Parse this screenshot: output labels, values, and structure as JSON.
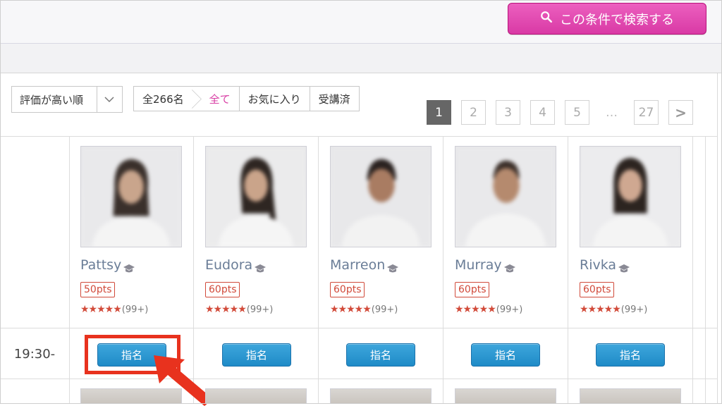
{
  "search": {
    "button_label": "この条件で検索する",
    "icon": "search-icon"
  },
  "toolbar": {
    "sort_value": "評価が高い順",
    "filters": [
      {
        "label": "全266名"
      },
      {
        "label": "全て"
      },
      {
        "label": "お気に入り"
      },
      {
        "label": "受講済"
      }
    ]
  },
  "pagination": {
    "pages": [
      "1",
      "2",
      "3",
      "4",
      "5",
      "…",
      "27"
    ],
    "current": "1",
    "next_label": ">"
  },
  "teachers": [
    {
      "name": "Pattsy",
      "points": "50pts",
      "reviews": "(99+)",
      "stars": "★★★★★"
    },
    {
      "name": "Eudora",
      "points": "60pts",
      "reviews": "(99+)",
      "stars": "★★★★★"
    },
    {
      "name": "Marreon",
      "points": "60pts",
      "reviews": "(99+)",
      "stars": "★★★★★"
    },
    {
      "name": "Murray",
      "points": "60pts",
      "reviews": "(99+)",
      "stars": "★★★★★"
    },
    {
      "name": "Rivka",
      "points": "60pts",
      "reviews": "(99+)",
      "stars": "★★★★★"
    }
  ],
  "schedule": {
    "time": "19:30-",
    "book_label": "指名"
  },
  "colors": {
    "accent": "#d83da4",
    "book_button": "#2496d2",
    "highlight": "#e8321e",
    "points": "#d14a3a"
  }
}
